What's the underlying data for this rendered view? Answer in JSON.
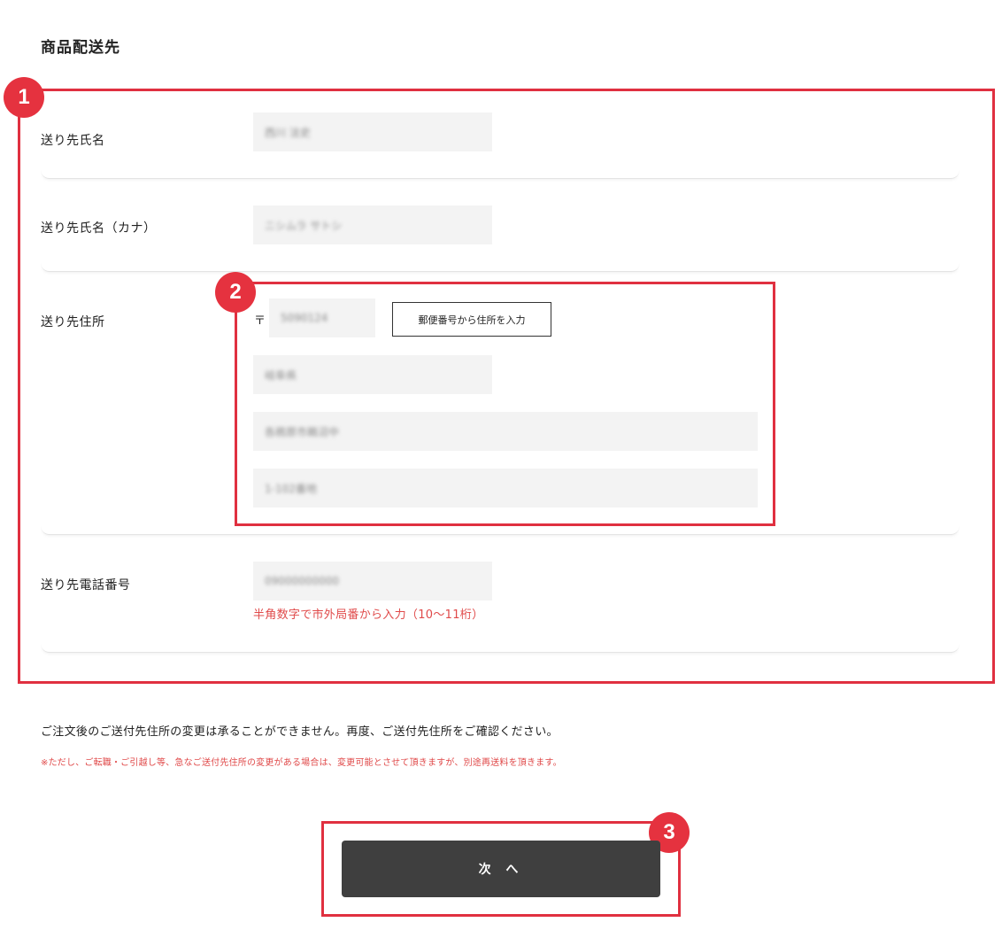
{
  "section_title": "商品配送先",
  "annotations": {
    "badge_1": "1",
    "badge_2": "2",
    "badge_3": "3"
  },
  "form": {
    "name": {
      "label": "送り先氏名",
      "value": "西川 法史"
    },
    "kana": {
      "label": "送り先氏名（カナ）",
      "value": "ニシムラ サトシ"
    },
    "address": {
      "label": "送り先住所",
      "zip_mark": "〒",
      "zip_value": "5090124",
      "zip_button": "郵便番号から住所を入力",
      "prefecture_value": "岐阜県",
      "city_value": "各務原市鵜沼中",
      "street_value": "1-102番地"
    },
    "phone": {
      "label": "送り先電話番号",
      "value": "09000000000",
      "hint": "半角数字で市外局番から入力（10〜11桁）"
    }
  },
  "notice": "ご注文後のご送付先住所の変更は承ることができません。再度、ご送付先住所をご確認ください。",
  "notice_small": "※ただし、ご転職・ご引越し等、急なご送付先住所の変更がある場合は、変更可能とさせて頂きますが、別途再送料を頂きます。",
  "next_button": "次 へ",
  "colors": {
    "annotation_red": "#e5323f",
    "hint_red": "#e04a4a",
    "button_dark": "#3f3f3f",
    "input_bg": "#f3f3f3"
  }
}
